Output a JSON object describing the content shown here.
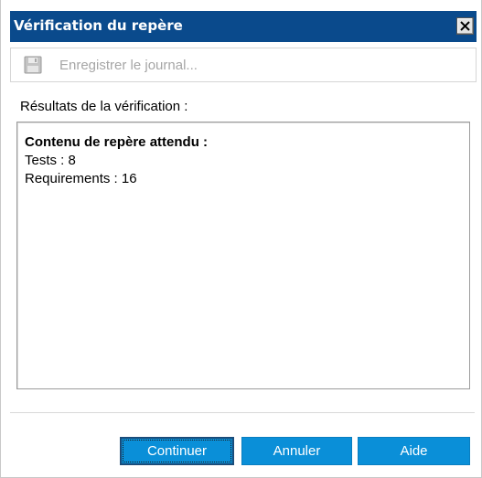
{
  "window": {
    "title": "Vérification du repère"
  },
  "toolbar": {
    "save_log_label": "Enregistrer le journal...",
    "save_icon": "floppy-disk-icon",
    "save_enabled": false
  },
  "results": {
    "label": "Résultats de la vérification :",
    "heading": "Contenu de repère attendu :",
    "lines": [
      "Tests : 8",
      "Requirements : 16"
    ]
  },
  "buttons": {
    "continue_label": "Continuer",
    "cancel_label": "Annuler",
    "help_label": "Aide"
  },
  "colors": {
    "titlebar": "#0a4a8c",
    "button": "#0a8fd8"
  }
}
